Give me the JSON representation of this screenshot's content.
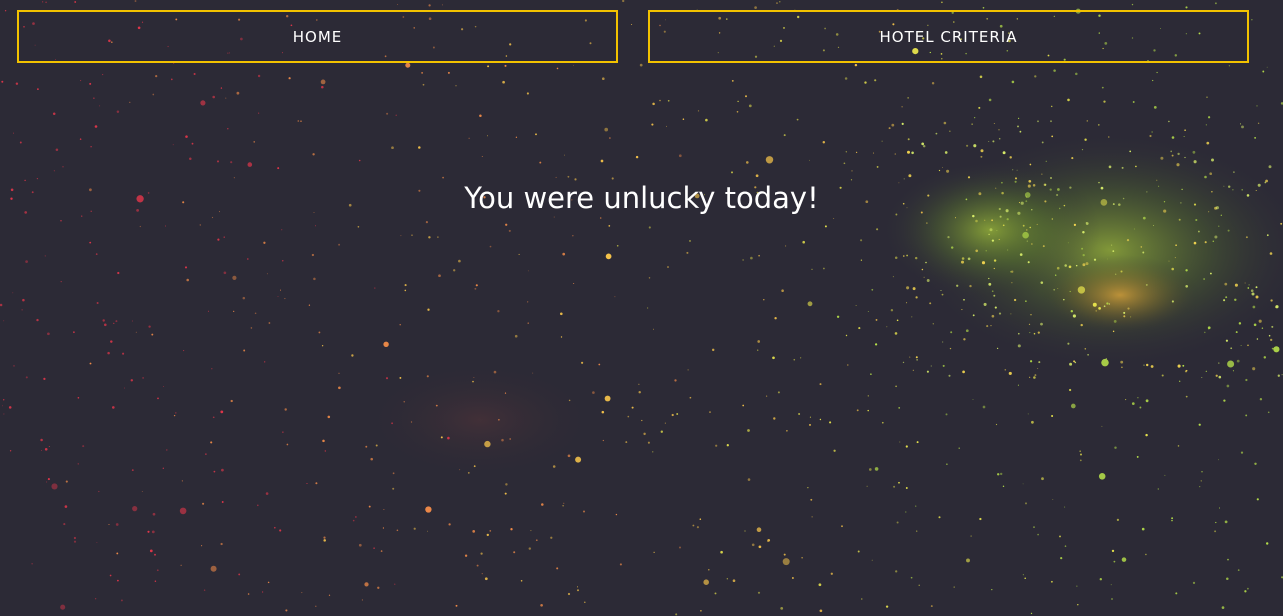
{
  "nav": {
    "home_label": "HOME",
    "criteria_label": "HOTEL CRITERIA",
    "border_color": "#f2c200"
  },
  "main": {
    "message": "You were unlucky today!"
  },
  "background": {
    "description": "",
    "base_color": "#2c2a36",
    "star_colors": [
      "#e0364a",
      "#ef8a48",
      "#f4c24a",
      "#e6e24c",
      "#b7e14a"
    ]
  }
}
